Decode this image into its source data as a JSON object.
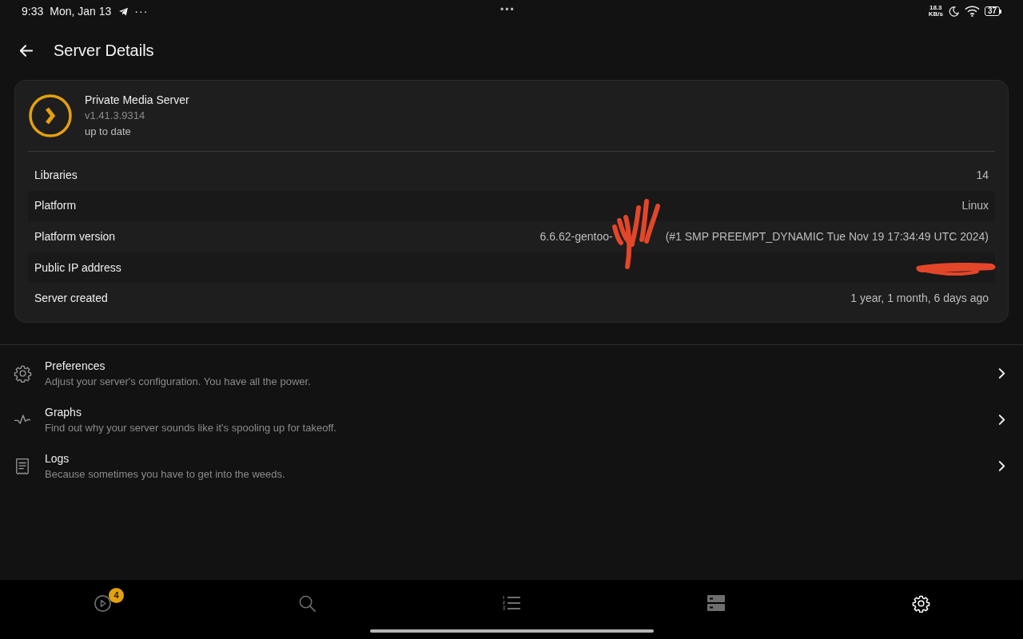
{
  "status_bar": {
    "time": "9:33",
    "date": "Mon, Jan 13",
    "more": "···",
    "center_dots": "•••",
    "net_speed": [
      "18.3",
      "KB/s"
    ],
    "battery": "37"
  },
  "header": {
    "title": "Server Details"
  },
  "server": {
    "name": "Private Media Server",
    "version": "v1.41.3.9314",
    "update_status": "up to date"
  },
  "details": [
    {
      "label": "Libraries",
      "value": "14"
    },
    {
      "label": "Platform",
      "value": "Linux"
    },
    {
      "label": "Platform version",
      "value_parts": [
        "6.6.62-gentoo-",
        "(#1 SMP PREEMPT_DYNAMIC Tue Nov 19 17:34:49 UTC 2024)"
      ],
      "redacted": true
    },
    {
      "label": "Public IP address",
      "redacted": true
    },
    {
      "label": "Server created",
      "value": "1 year, 1 month, 6 days ago"
    }
  ],
  "menu": [
    {
      "kind": "gear",
      "title": "Preferences",
      "subtitle": "Adjust your server's configuration. You have all the power."
    },
    {
      "kind": "pulse",
      "title": "Graphs",
      "subtitle": "Find out why your server sounds like it's spooling up for takeoff."
    },
    {
      "kind": "document",
      "title": "Logs",
      "subtitle": "Because sometimes you have to get into the weeds."
    }
  ],
  "nav": [
    {
      "kind": "play",
      "badge": "4",
      "selected": false
    },
    {
      "kind": "search",
      "selected": false
    },
    {
      "kind": "list",
      "selected": false
    },
    {
      "kind": "servers",
      "selected": false
    },
    {
      "kind": "settings",
      "selected": true
    }
  ]
}
